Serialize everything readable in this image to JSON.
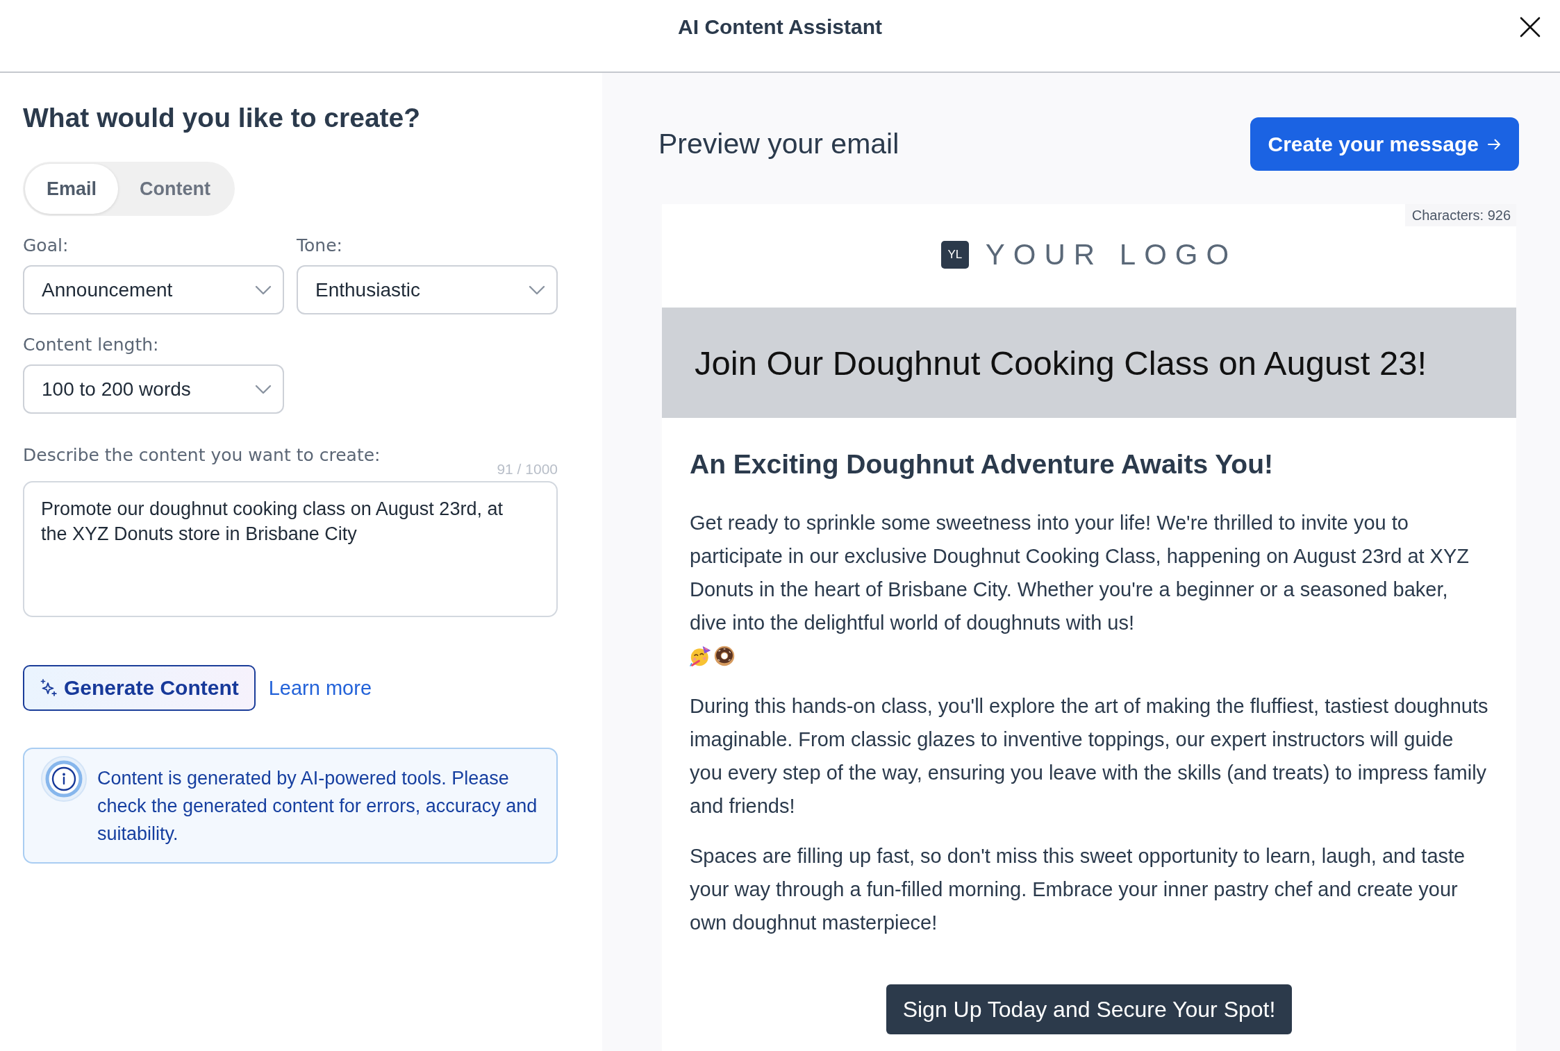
{
  "window": {
    "title": "AI Content Assistant"
  },
  "form": {
    "heading": "What would you like to create?",
    "modes": [
      {
        "label": "Email",
        "selected": true
      },
      {
        "label": "Content",
        "selected": false
      }
    ],
    "fields": [
      {
        "label": "Goal:",
        "value": "Announcement"
      },
      {
        "label": "Tone:",
        "value": "Enthusiastic"
      },
      {
        "label": "Content length:",
        "value": "100 to 200 words"
      }
    ],
    "description": {
      "label": "Describe the content you want to create:",
      "counter": "91 / 1000",
      "value": "Promote our doughnut cooking class on August 23rd, at the XYZ Donuts store in Brisbane City"
    },
    "generate_button": "Generate Content",
    "learn_more_link": "Learn more",
    "notice": "Content is generated by AI-powered tools. Please check the generated content for errors, accuracy and suitability."
  },
  "preview": {
    "heading": "Preview your email",
    "create_button": "Create your message",
    "email": {
      "character_count": "Characters: 926",
      "logo_badge": "YL",
      "logo_text": "YOUR LOGO",
      "banner_title": "Join Our Doughnut Cooking Class on August 23!",
      "subheading": "An Exciting Doughnut Adventure Awaits You!",
      "paragraphs": [
        {
          "kind": "emoji",
          "text": "Get ready to sprinkle some sweetness into your life! We're thrilled to invite you to participate in our exclusive Doughnut Cooking Class, happening on August 23rd at XYZ Donuts in the heart of Brisbane City. Whether you're a beginner or a seasoned baker, dive into the delightful world of doughnuts with us!"
        },
        {
          "kind": "plain",
          "text": "During this hands-on class, you'll explore the art of making the fluffiest, tastiest doughnuts imaginable. From classic glazes to inventive toppings, our expert instructors will guide you every step of the way, ensuring you leave with the skills (and treats) to impress family and friends!"
        },
        {
          "kind": "plain",
          "text": "Spaces are filling up fast, so don't miss this sweet opportunity to learn, laugh, and taste your way through a fun-filled morning. Embrace your inner pastry chef and create your own doughnut masterpiece!"
        }
      ],
      "cta_button": "Sign Up Today and Secure Your Spot!"
    }
  }
}
